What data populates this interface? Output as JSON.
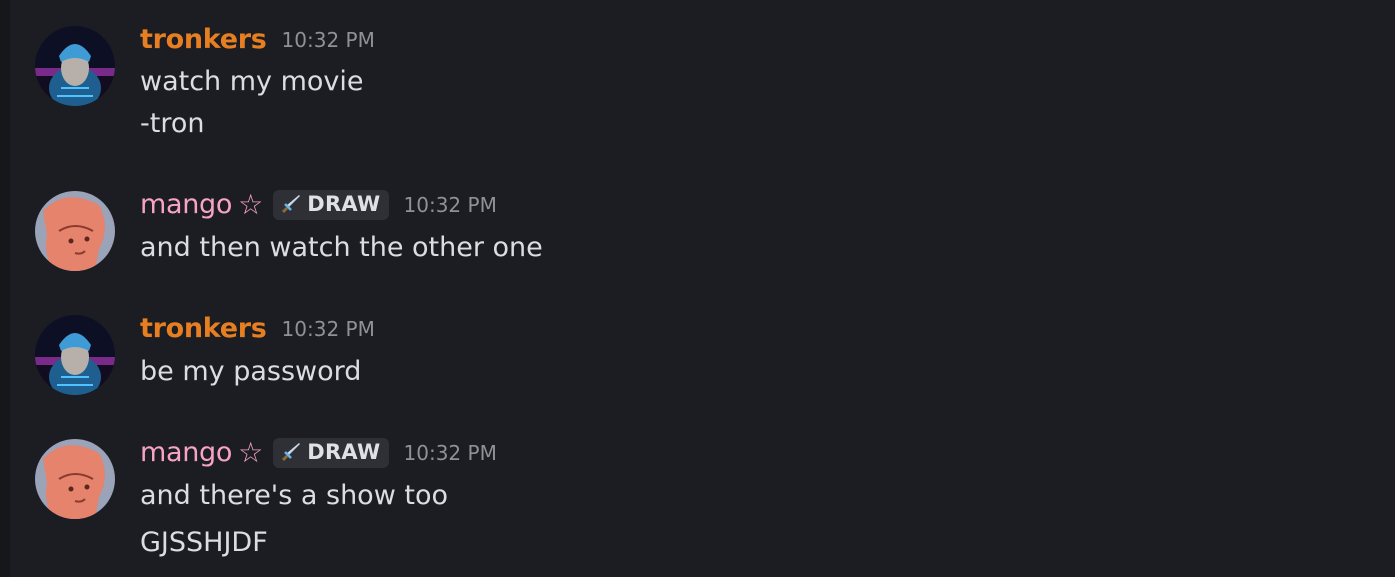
{
  "messages": [
    {
      "author": "tronkers",
      "timestamp": "10:32 PM",
      "lines": [
        "watch my movie",
        "-tron"
      ]
    },
    {
      "author": "mango",
      "decoration": "☆",
      "tag": "DRAW",
      "timestamp": "10:32 PM",
      "lines": [
        "and then watch the other one"
      ]
    },
    {
      "author": "tronkers",
      "timestamp": "10:32 PM",
      "lines": [
        "be my password"
      ]
    },
    {
      "author": "mango",
      "decoration": "☆",
      "tag": "DRAW",
      "timestamp": "10:32 PM",
      "lines": [
        "and there's a show too",
        "GJSSHJDF"
      ]
    }
  ],
  "colors": {
    "background": "#1c1d22",
    "tronkers_name": "#e67e22",
    "mango_name": "#f7a3c8",
    "text": "#dbdee1",
    "timestamp": "#8e9198"
  },
  "icons": {
    "tag_icon": "sword-icon"
  }
}
